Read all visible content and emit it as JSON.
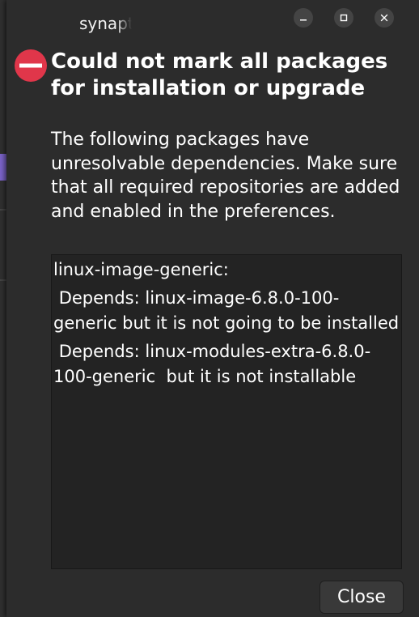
{
  "window": {
    "title": "synaptic",
    "controls": [
      "minimize",
      "maximize",
      "close"
    ]
  },
  "dialog": {
    "heading": "Could not mark all packages for installation or upgrade",
    "message": "The following packages have unresolvable dependencies. Make sure that all required repositories are added and enabled in the preferences.",
    "details": {
      "package": "linux-image-generic:",
      "dependencies": [
        " Depends: linux-image-6.8.0-100-generic but it is not going to be installed",
        " Depends: linux-modules-extra-6.8.0-100-generic  but it is not installable"
      ]
    },
    "close_label": "Close"
  },
  "icons": {
    "error": "error-icon",
    "minimize": "minimize-icon",
    "maximize": "maximize-icon",
    "close": "close-icon"
  },
  "colors": {
    "error_red": "#e0364a",
    "dialog_bg": "#2c2c2c",
    "accent_purple": "#7b63c7"
  }
}
